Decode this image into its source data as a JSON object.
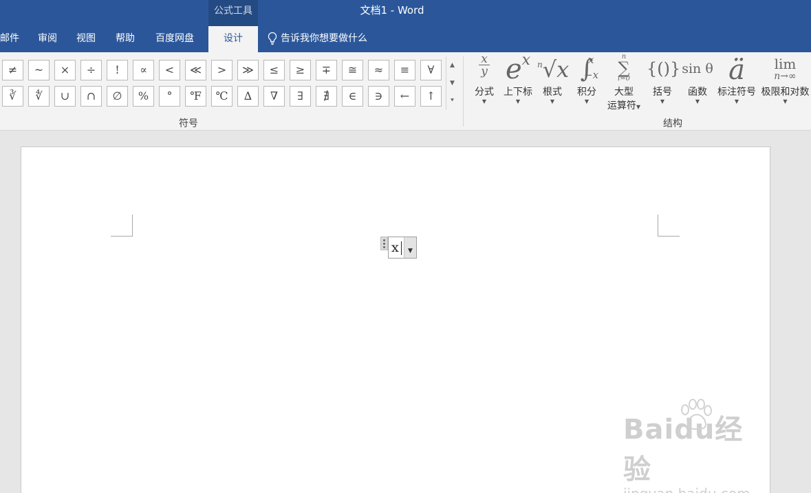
{
  "window": {
    "context_tab": "公式工具",
    "title": "文档1  -  Word"
  },
  "tabs": [
    {
      "label": "邮件"
    },
    {
      "label": "审阅"
    },
    {
      "label": "视图"
    },
    {
      "label": "帮助"
    },
    {
      "label": "百度网盘"
    },
    {
      "label": "设计",
      "active": true
    }
  ],
  "tell_me": {
    "label": "告诉我你想要做什么"
  },
  "symbols": {
    "row1": [
      "≠",
      "~",
      "×",
      "÷",
      "!",
      "∝",
      "<",
      "≪",
      ">",
      "≫",
      "≤",
      "≥",
      "∓",
      "≅",
      "≈",
      "≡",
      "∀"
    ],
    "row2": [
      "∛",
      "∜",
      "∪",
      "∩",
      "∅",
      "%",
      "°",
      "℉",
      "℃",
      "∆",
      "∇",
      "∃",
      "∄",
      "∈",
      "∋",
      "←",
      "↑"
    ],
    "group_label": "符号"
  },
  "structures": {
    "group_label": "结构",
    "items": [
      {
        "label": "分式",
        "icon": "fraction-icon"
      },
      {
        "label": "上下标",
        "icon": "script-icon"
      },
      {
        "label": "根式",
        "icon": "radical-icon"
      },
      {
        "label": "积分",
        "icon": "integral-icon"
      },
      {
        "label_line1": "大型",
        "label_line2": "运算符",
        "icon": "large-operator-icon"
      },
      {
        "label": "括号",
        "icon": "bracket-icon"
      },
      {
        "label": "函数",
        "icon": "function-icon"
      },
      {
        "label": "标注符号",
        "icon": "accent-icon"
      },
      {
        "label": "极限和对数",
        "icon": "limit-log-icon"
      }
    ]
  },
  "equation": {
    "text": "x"
  },
  "watermark": {
    "main": "Baidu经验",
    "sub": "jingyan.baidu.com"
  },
  "colors": {
    "titlebar": "#2b579a",
    "ribbon": "#f3f3f3",
    "canvas": "#e6e6e6"
  }
}
